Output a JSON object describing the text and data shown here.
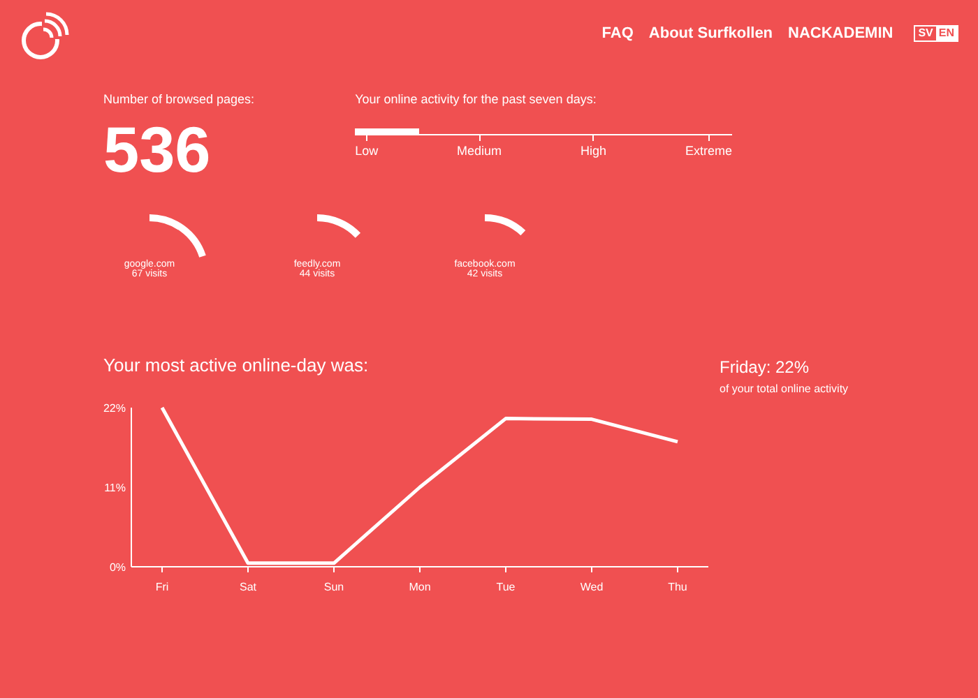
{
  "nav": {
    "links": [
      "FAQ",
      "About Surfkollen",
      "NACKADEMIN"
    ],
    "languages": [
      {
        "label": "SV",
        "selected": false
      },
      {
        "label": "EN",
        "selected": true
      }
    ]
  },
  "browsed": {
    "label": "Number of browsed pages:",
    "value": "536"
  },
  "activity": {
    "label": "Your online activity for the past seven days:",
    "level": 0.17,
    "scale": [
      "Low",
      "Medium",
      "High",
      "Extreme"
    ]
  },
  "sites": [
    {
      "name": "google.com",
      "visits": "67 visits"
    },
    {
      "name": "feedly.com",
      "visits": "44 visits"
    },
    {
      "name": "facebook.com",
      "visits": "42 visits"
    }
  ],
  "most_active": {
    "title": "Your most active online-day was:",
    "highlight": "Friday: 22%",
    "caption": "of your total online activity",
    "chart_data": {
      "type": "line",
      "categories": [
        "Fri",
        "Sat",
        "Sun",
        "Mon",
        "Tue",
        "Wed",
        "Thu"
      ],
      "series": [
        {
          "color": "#ffffff",
          "values": [
            22,
            0.5,
            0.5,
            11,
            20.5,
            20.4,
            17.3
          ]
        }
      ],
      "ylim": [
        0,
        22
      ],
      "yticks": [
        {
          "value": 0,
          "label": "0%"
        },
        {
          "value": 11,
          "label": "11%"
        },
        {
          "value": 22,
          "label": "22%"
        }
      ]
    }
  }
}
